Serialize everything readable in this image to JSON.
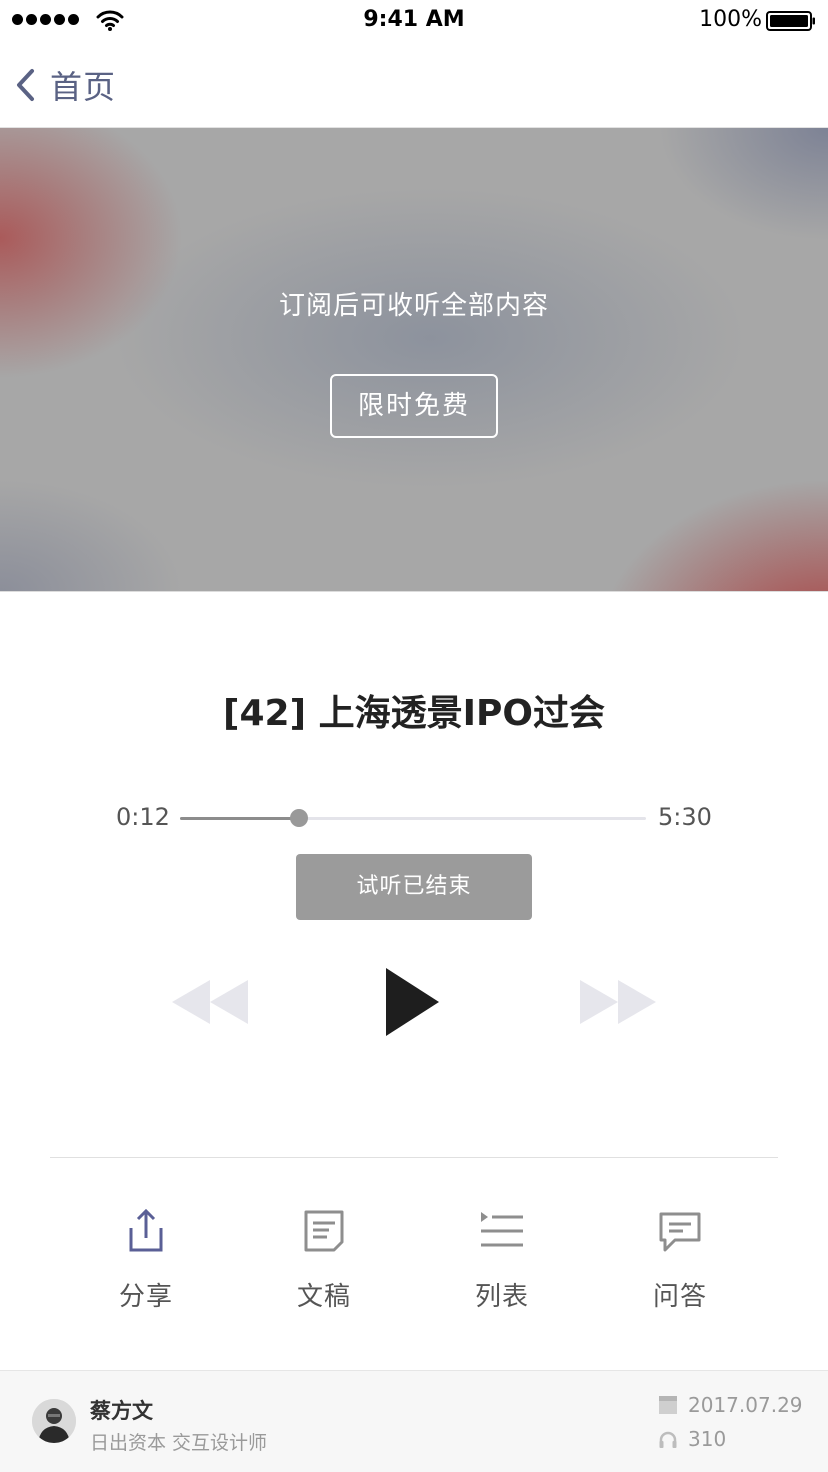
{
  "status_bar": {
    "time": "9:41 AM",
    "battery_percent": "100%",
    "signal_icon": "signal-dots-icon",
    "wifi_icon": "wifi-icon",
    "battery_icon": "battery-icon"
  },
  "nav": {
    "back_label": "首页",
    "back_icon": "chevron-left-icon",
    "accent_color": "#5a6284"
  },
  "hero": {
    "message": "订阅后可收听全部内容",
    "button_label": "限时免费"
  },
  "episode": {
    "title": "[42] 上海透景IPO过会"
  },
  "player": {
    "current_time": "0:12",
    "total_time": "5:30",
    "progress_fraction": 0.255,
    "trial_label": "试听已结束",
    "rewind_icon": "rewind-icon",
    "play_icon": "play-icon",
    "forward_icon": "fast-forward-icon"
  },
  "actions": [
    {
      "label": "分享",
      "icon": "share-icon",
      "color": "#5a5f96"
    },
    {
      "label": "文稿",
      "icon": "document-icon",
      "color": "#8e8e8e"
    },
    {
      "label": "列表",
      "icon": "playlist-icon",
      "color": "#8e8e8e"
    },
    {
      "label": "问答",
      "icon": "comment-icon",
      "color": "#8e8e8e"
    }
  ],
  "footer": {
    "author_name": "蔡方文",
    "author_desc": "日出资本 交互设计师",
    "date": "2017.07.29",
    "plays": "310",
    "date_icon": "calendar-icon",
    "plays_icon": "headphones-icon"
  }
}
